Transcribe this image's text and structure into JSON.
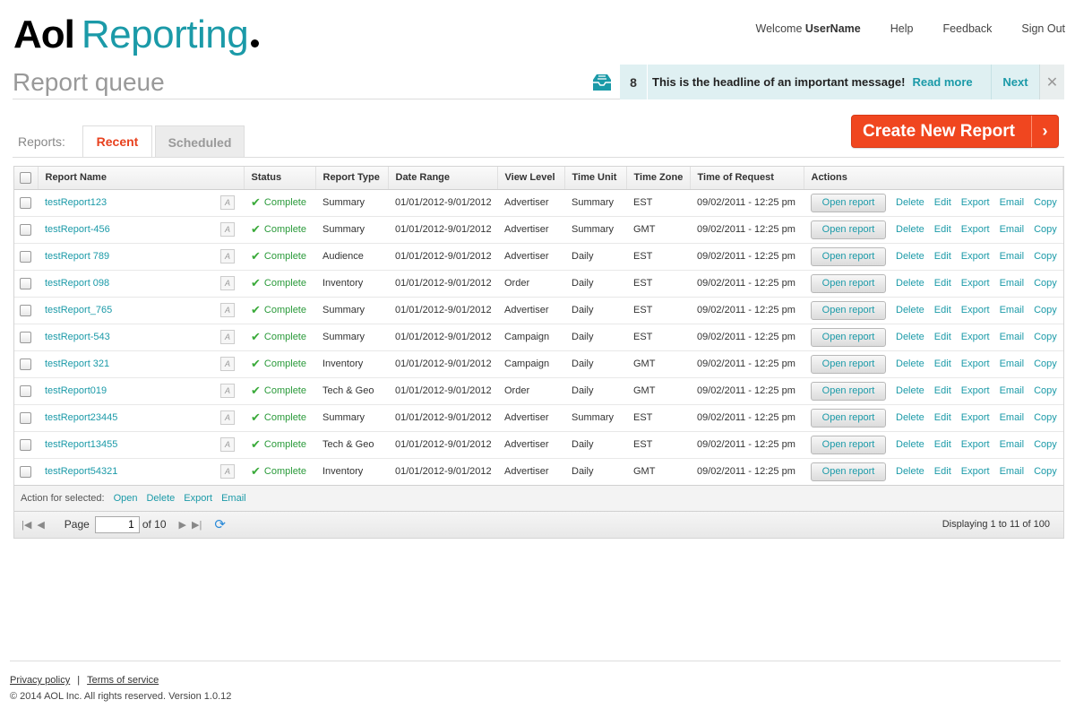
{
  "brand": {
    "aol": "Aol",
    "product": "Reporting"
  },
  "topnav": {
    "welcome_prefix": "Welcome",
    "username": "UserName",
    "help": "Help",
    "feedback": "Feedback",
    "signout": "Sign Out"
  },
  "page_title": "Report queue",
  "message": {
    "count": "8",
    "headline": "This  is the headline of an important message!",
    "read_more": "Read more",
    "next": "Next",
    "close": "✕"
  },
  "tabs": {
    "label": "Reports:",
    "recent": "Recent",
    "scheduled": "Scheduled"
  },
  "create_button": "Create New Report",
  "columns": [
    "Report Name",
    "Status",
    "Report Type",
    "Date Range",
    "View Level",
    "Time Unit",
    "Time Zone",
    "Time of Request",
    "Actions"
  ],
  "row_actions": {
    "open": "Open report",
    "delete": "Delete",
    "edit": "Edit",
    "export": "Export",
    "email": "Email",
    "copy": "Copy"
  },
  "rows": [
    {
      "name": "testReport123",
      "status": "Complete",
      "type": "Summary",
      "range": "01/01/2012-9/01/2012",
      "level": "Advertiser",
      "unit": "Summary",
      "zone": "EST",
      "requested": "09/02/2011 - 12:25 pm"
    },
    {
      "name": "testReport-456",
      "status": "Complete",
      "type": "Summary",
      "range": "01/01/2012-9/01/2012",
      "level": "Advertiser",
      "unit": "Summary",
      "zone": "GMT",
      "requested": "09/02/2011 - 12:25 pm"
    },
    {
      "name": "testReport 789",
      "status": "Complete",
      "type": "Audience",
      "range": "01/01/2012-9/01/2012",
      "level": "Advertiser",
      "unit": "Daily",
      "zone": "EST",
      "requested": "09/02/2011 - 12:25 pm"
    },
    {
      "name": "testReport 098",
      "status": "Complete",
      "type": "Inventory",
      "range": "01/01/2012-9/01/2012",
      "level": "Order",
      "unit": "Daily",
      "zone": "EST",
      "requested": "09/02/2011 - 12:25 pm"
    },
    {
      "name": "testReport_765",
      "status": "Complete",
      "type": "Summary",
      "range": "01/01/2012-9/01/2012",
      "level": "Advertiser",
      "unit": "Daily",
      "zone": "EST",
      "requested": "09/02/2011 - 12:25 pm"
    },
    {
      "name": "testReport-543",
      "status": "Complete",
      "type": "Summary",
      "range": "01/01/2012-9/01/2012",
      "level": "Campaign",
      "unit": "Daily",
      "zone": "EST",
      "requested": "09/02/2011 - 12:25 pm"
    },
    {
      "name": "testReport 321",
      "status": "Complete",
      "type": "Inventory",
      "range": "01/01/2012-9/01/2012",
      "level": "Campaign",
      "unit": "Daily",
      "zone": "GMT",
      "requested": "09/02/2011 - 12:25 pm"
    },
    {
      "name": "testReport019",
      "status": "Complete",
      "type": "Tech & Geo",
      "range": "01/01/2012-9/01/2012",
      "level": "Order",
      "unit": "Daily",
      "zone": "GMT",
      "requested": "09/02/2011 - 12:25 pm"
    },
    {
      "name": "testReport23445",
      "status": "Complete",
      "type": "Summary",
      "range": "01/01/2012-9/01/2012",
      "level": "Advertiser",
      "unit": "Summary",
      "zone": "EST",
      "requested": "09/02/2011 - 12:25 pm"
    },
    {
      "name": "testReport13455",
      "status": "Complete",
      "type": "Tech & Geo",
      "range": "01/01/2012-9/01/2012",
      "level": "Advertiser",
      "unit": "Daily",
      "zone": "EST",
      "requested": "09/02/2011 - 12:25 pm"
    },
    {
      "name": "testReport54321",
      "status": "Complete",
      "type": "Inventory",
      "range": "01/01/2012-9/01/2012",
      "level": "Advertiser",
      "unit": "Daily",
      "zone": "GMT",
      "requested": "09/02/2011 - 12:25 pm"
    }
  ],
  "bulk_actions": {
    "label": "Action for selected:",
    "open": "Open",
    "delete": "Delete",
    "export": "Export",
    "email": "Email"
  },
  "pager": {
    "page_label": "Page",
    "page_value": "1",
    "of_label": "of 10",
    "displaying": "Displaying 1 to 11  of 100"
  },
  "footer": {
    "privacy": "Privacy policy",
    "separator": "|",
    "terms": "Terms of service",
    "copyright": "© 2014 AOL Inc. All rights reserved. Version 1.0.12"
  },
  "colors": {
    "accent": "#1b9aa8",
    "primary_button": "#f0461f",
    "status_ok": "#2a9a3a"
  }
}
